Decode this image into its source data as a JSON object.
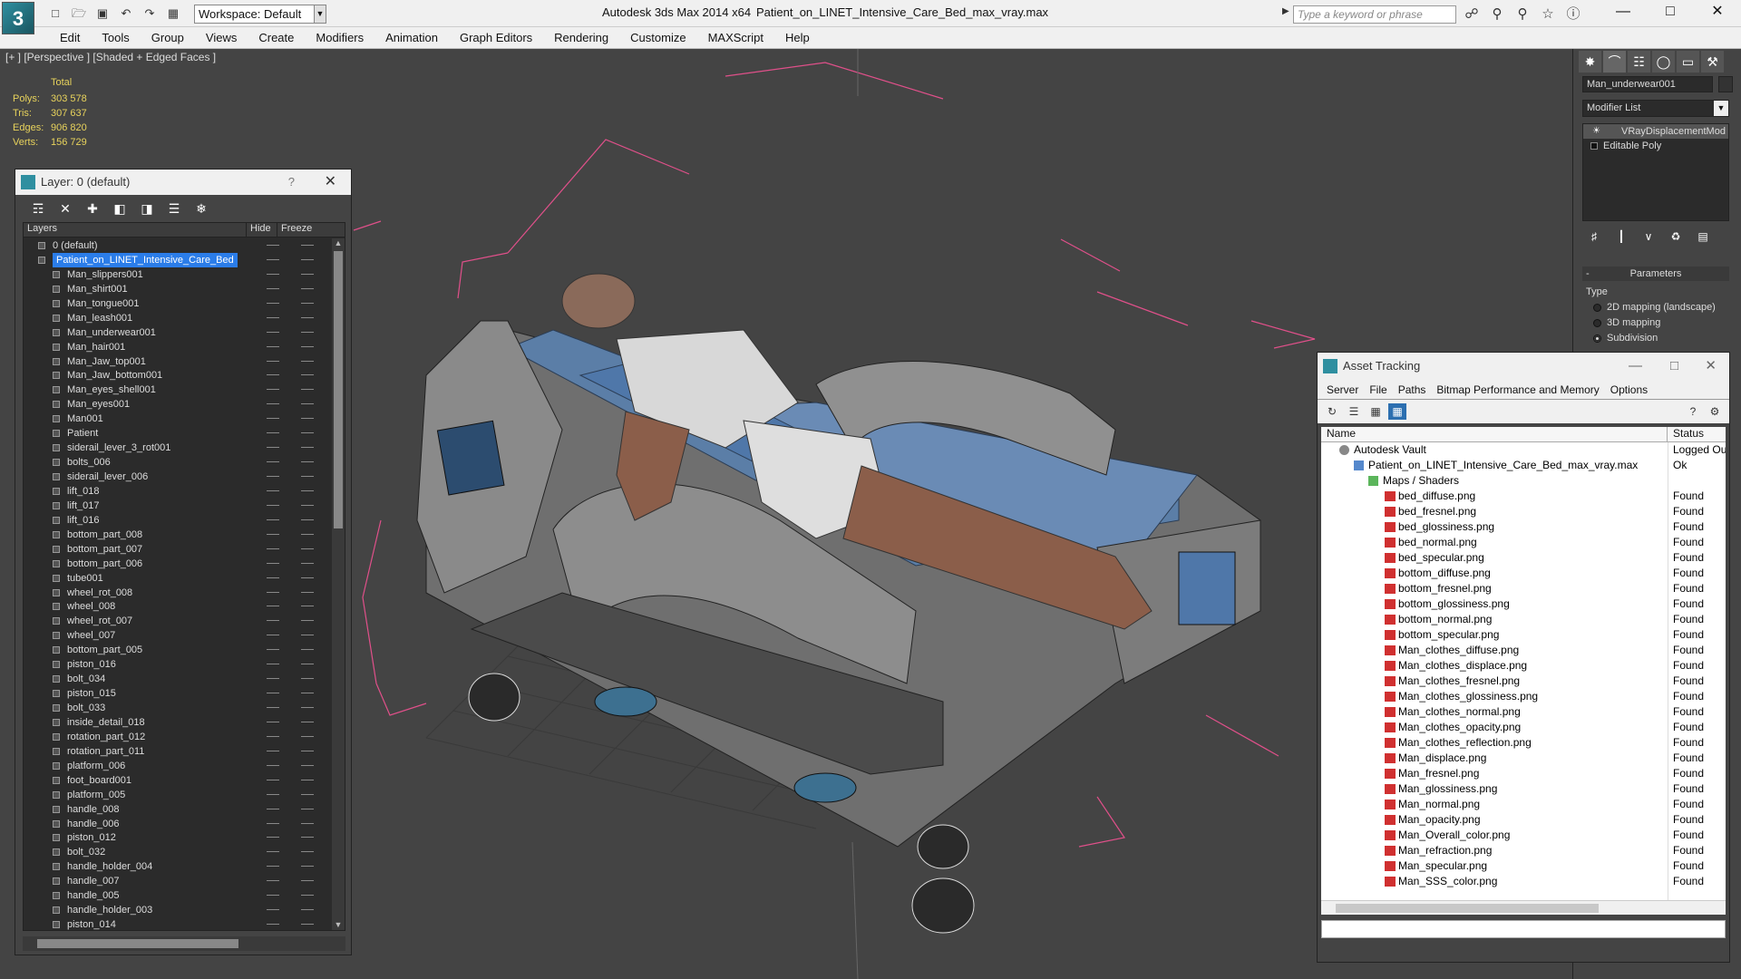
{
  "titlebar": {
    "app_title": "Autodesk 3ds Max  2014 x64",
    "file_title": "Patient_on_LINET_Intensive_Care_Bed_max_vray.max",
    "workspace": "Workspace: Default",
    "search_placeholder": "Type a keyword or phrase"
  },
  "menu": [
    "Edit",
    "Tools",
    "Group",
    "Views",
    "Create",
    "Modifiers",
    "Animation",
    "Graph Editors",
    "Rendering",
    "Customize",
    "MAXScript",
    "Help"
  ],
  "viewport": {
    "label": "[+ ] [Perspective ] [Shaded + Edged Faces ]",
    "stats_header": "Total",
    "stats": [
      {
        "k": "Polys:",
        "v": "303 578"
      },
      {
        "k": "Tris:",
        "v": "307 637"
      },
      {
        "k": "Edges:",
        "v": "906 820"
      },
      {
        "k": "Verts:",
        "v": "156 729"
      }
    ]
  },
  "layer_dialog": {
    "title": "Layer: 0 (default)",
    "help": "?",
    "columns": [
      "Layers",
      "Hide",
      "Freeze"
    ],
    "rows": [
      "0 (default)",
      "Patient_on_LINET_Intensive_Care_Bed",
      "Man_slippers001",
      "Man_shirt001",
      "Man_tongue001",
      "Man_leash001",
      "Man_underwear001",
      "Man_hair001",
      "Man_Jaw_top001",
      "Man_Jaw_bottom001",
      "Man_eyes_shell001",
      "Man_eyes001",
      "Man001",
      "Patient",
      "siderail_lever_3_rot001",
      "bolts_006",
      "siderail_lever_006",
      "lift_018",
      "lift_017",
      "lift_016",
      "bottom_part_008",
      "bottom_part_007",
      "bottom_part_006",
      "tube001",
      "wheel_rot_008",
      "wheel_008",
      "wheel_rot_007",
      "wheel_007",
      "bottom_part_005",
      "piston_016",
      "bolt_034",
      "piston_015",
      "bolt_033",
      "inside_detail_018",
      "rotation_part_012",
      "rotation_part_011",
      "platform_006",
      "foot_board001",
      "platform_005",
      "handle_008",
      "handle_006",
      "piston_012",
      "bolt_032",
      "handle_holder_004",
      "handle_007",
      "handle_005",
      "handle_holder_003",
      "piston_014"
    ]
  },
  "command_panel": {
    "object_name": "Man_underwear001",
    "modifier_list": "Modifier List",
    "stack": [
      "VRayDisplacementMod",
      "Editable Poly"
    ],
    "parameters_title": "Parameters",
    "type_label": "Type",
    "types": [
      "2D mapping (landscape)",
      "3D mapping",
      "Subdivision"
    ],
    "selected_type": "Subdivision"
  },
  "asset_tracking": {
    "title": "Asset Tracking",
    "menu": [
      "Server",
      "File",
      "Paths",
      "Bitmap Performance and Memory",
      "Options"
    ],
    "columns": [
      "Name",
      "Status"
    ],
    "rows": [
      {
        "name": "Autodesk Vault",
        "status": "Logged Ou",
        "level": 0
      },
      {
        "name": "Patient_on_LINET_Intensive_Care_Bed_max_vray.max",
        "status": "Ok",
        "level": 1
      },
      {
        "name": "Maps / Shaders",
        "status": "",
        "level": 2
      },
      {
        "name": "bed_diffuse.png",
        "status": "Found",
        "level": 3
      },
      {
        "name": "bed_fresnel.png",
        "status": "Found",
        "level": 3
      },
      {
        "name": "bed_glossiness.png",
        "status": "Found",
        "level": 3
      },
      {
        "name": "bed_normal.png",
        "status": "Found",
        "level": 3
      },
      {
        "name": "bed_specular.png",
        "status": "Found",
        "level": 3
      },
      {
        "name": "bottom_diffuse.png",
        "status": "Found",
        "level": 3
      },
      {
        "name": "bottom_fresnel.png",
        "status": "Found",
        "level": 3
      },
      {
        "name": "bottom_glossiness.png",
        "status": "Found",
        "level": 3
      },
      {
        "name": "bottom_normal.png",
        "status": "Found",
        "level": 3
      },
      {
        "name": "bottom_specular.png",
        "status": "Found",
        "level": 3
      },
      {
        "name": "Man_clothes_diffuse.png",
        "status": "Found",
        "level": 3
      },
      {
        "name": "Man_clothes_displace.png",
        "status": "Found",
        "level": 3
      },
      {
        "name": "Man_clothes_fresnel.png",
        "status": "Found",
        "level": 3
      },
      {
        "name": "Man_clothes_glossiness.png",
        "status": "Found",
        "level": 3
      },
      {
        "name": "Man_clothes_normal.png",
        "status": "Found",
        "level": 3
      },
      {
        "name": "Man_clothes_opacity.png",
        "status": "Found",
        "level": 3
      },
      {
        "name": "Man_clothes_reflection.png",
        "status": "Found",
        "level": 3
      },
      {
        "name": "Man_displace.png",
        "status": "Found",
        "level": 3
      },
      {
        "name": "Man_fresnel.png",
        "status": "Found",
        "level": 3
      },
      {
        "name": "Man_glossiness.png",
        "status": "Found",
        "level": 3
      },
      {
        "name": "Man_normal.png",
        "status": "Found",
        "level": 3
      },
      {
        "name": "Man_opacity.png",
        "status": "Found",
        "level": 3
      },
      {
        "name": "Man_Overall_color.png",
        "status": "Found",
        "level": 3
      },
      {
        "name": "Man_refraction.png",
        "status": "Found",
        "level": 3
      },
      {
        "name": "Man_specular.png",
        "status": "Found",
        "level": 3
      },
      {
        "name": "Man_SSS_color.png",
        "status": "Found",
        "level": 3
      }
    ]
  },
  "colors": {
    "selection": "#2b7de9",
    "stats_text": "#e8d35c",
    "bounding_box": "#e0508a",
    "accent": "#2f8fa0"
  }
}
